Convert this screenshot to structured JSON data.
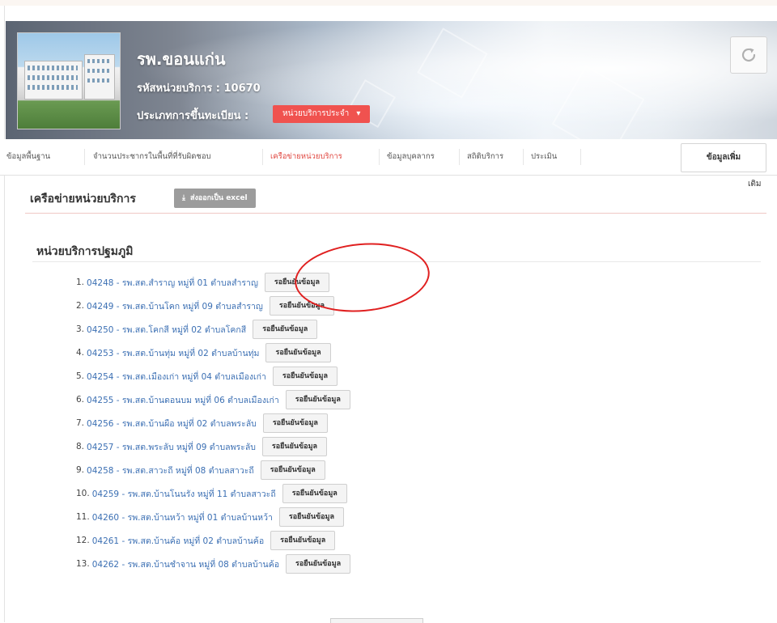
{
  "header": {
    "hospital_name": "รพ.ขอนแก่น",
    "service_code": "รหัสหน่วยบริการ : 10670",
    "registration_label": "ประเภทการขึ้นทะเบียน :",
    "registration_value": "หน่วยบริการประจำ",
    "registration_caret": "▾"
  },
  "nav": {
    "tabs": [
      "ข้อมูลพื้นฐาน",
      "จำนวนประชากรในพื้นที่ที่รับผิดชอบ",
      "เครือข่ายหน่วยบริการ",
      "ข้อมูลบุคลากร",
      "สถิติบริการ",
      "ประเมิน"
    ],
    "active_tab": "เครือข่ายหน่วยบริการ",
    "more_label": "ข้อมูลเพิ่ม",
    "more_label_wrap": "เติม"
  },
  "network": {
    "title": "เครือข่ายหน่วยบริการ",
    "export_label": "ส่งออกเป็น excel",
    "primary_title": "หน่วยบริการปฐมภูมิ",
    "pending_label": "รอยืนยันข้อมูล",
    "units": [
      {
        "num": "1.",
        "text": "04248 - รพ.สต.สำราญ หมู่ที่ 01 ตำบลสำราญ"
      },
      {
        "num": "2.",
        "text": "04249 - รพ.สต.บ้านโคก หมู่ที่ 09 ตำบลสำราญ"
      },
      {
        "num": "3.",
        "text": "04250 - รพ.สต.โคกสี หมู่ที่ 02 ตำบลโคกสี"
      },
      {
        "num": "4.",
        "text": "04253 - รพ.สต.บ้านทุ่ม หมู่ที่ 02 ตำบลบ้านทุ่ม"
      },
      {
        "num": "5.",
        "text": "04254 - รพ.สต.เมืองเก่า หมู่ที่ 04 ตำบลเมืองเก่า"
      },
      {
        "num": "6.",
        "text": "04255 - รพ.สต.บ้านดอนบม หมู่ที่ 06 ตำบลเมืองเก่า"
      },
      {
        "num": "7.",
        "text": "04256 - รพ.สต.บ้านผือ หมู่ที่ 02 ตำบลพระลับ"
      },
      {
        "num": "8.",
        "text": "04257 - รพ.สต.พระลับ หมู่ที่ 09 ตำบลพระลับ"
      },
      {
        "num": "9.",
        "text": "04258 - รพ.สต.สาวะถี หมู่ที่ 08 ตำบลสาวะถี"
      },
      {
        "num": "10.",
        "text": "04259 - รพ.สต.บ้านโนนรัง หมู่ที่ 11 ตำบลสาวะถี"
      },
      {
        "num": "11.",
        "text": "04260 - รพ.สต.บ้านหว้า หมู่ที่ 01 ตำบลบ้านหว้า"
      },
      {
        "num": "12.",
        "text": "04261 - รพ.สต.บ้านค้อ หมู่ที่ 02 ตำบลบ้านค้อ"
      },
      {
        "num": "13.",
        "text": "04262 - รพ.สต.บ้านชำจาน หมู่ที่ 08 ตำบลบ้านค้อ"
      }
    ]
  },
  "colors": {
    "accent": "#f0524f",
    "link": "#3b6fb3",
    "highlight": "#e02020"
  }
}
